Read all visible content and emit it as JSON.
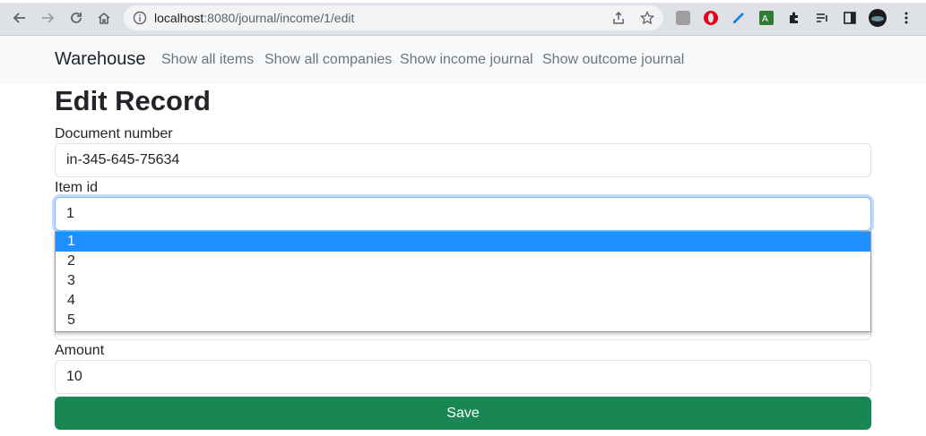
{
  "browser": {
    "url_host": "localhost",
    "url_path": ":8080/journal/income/1/edit"
  },
  "navbar": {
    "brand": "Warehouse",
    "links": [
      "Show all items",
      "Show all companies",
      "Show income journal",
      "Show outcome journal"
    ]
  },
  "page": {
    "title": "Edit Record"
  },
  "form": {
    "document_number": {
      "label": "Document number",
      "value": "in-345-645-75634"
    },
    "item_id": {
      "label": "Item id",
      "value": "1",
      "options": [
        "1",
        "2",
        "3",
        "4",
        "5"
      ],
      "selected_index": 0
    },
    "amount": {
      "label": "Amount",
      "value": "10"
    },
    "save_label": "Save"
  },
  "colors": {
    "navbar_bg": "#f8f9fa",
    "save_button": "#198754",
    "selected_option": "#1e90ff",
    "focus_ring": "#86b7fe"
  }
}
